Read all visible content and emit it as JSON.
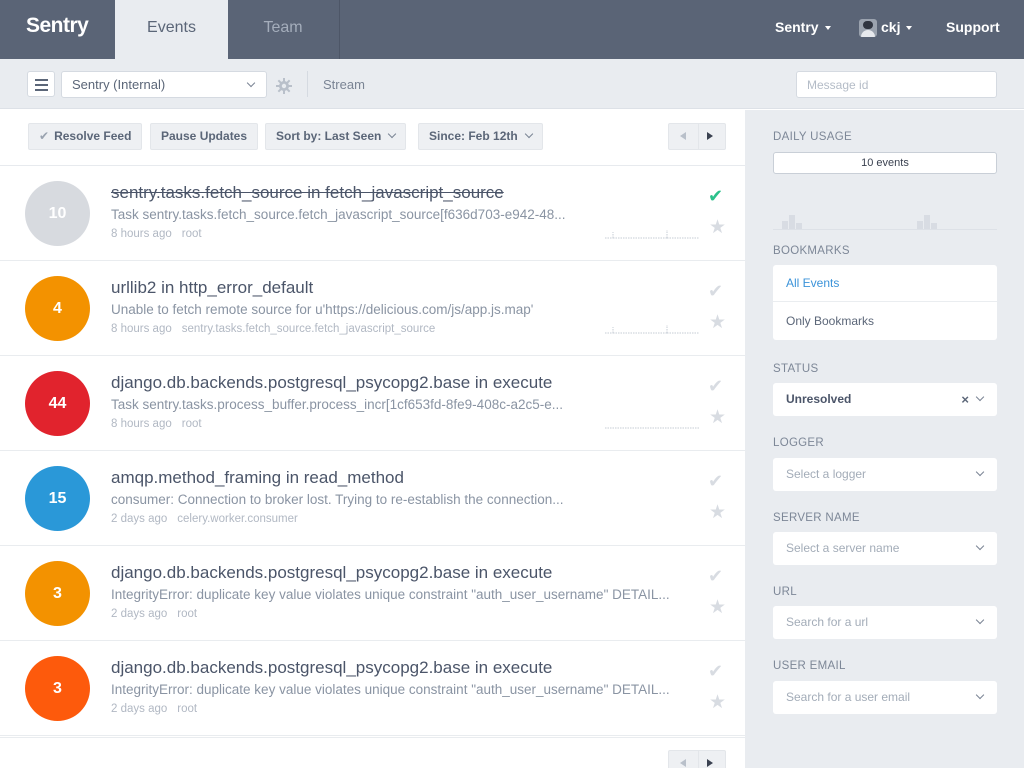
{
  "nav": {
    "brand": "Sentry",
    "tabs": [
      {
        "label": "Events"
      },
      {
        "label": "Team"
      }
    ],
    "org_menu": "Sentry",
    "user_menu": "ckj",
    "support": "Support",
    "colors": {
      "bar": "#5a6476",
      "active_tab": "#e9ecf0"
    }
  },
  "subbar": {
    "project": "Sentry (Internal)",
    "section": "Stream",
    "search": {
      "placeholder": "Message id",
      "value": ""
    }
  },
  "toolbar": {
    "resolve": "Resolve Feed",
    "pause": "Pause Updates",
    "sort": "Sort by: Last Seen",
    "since": "Since: Feb 12th"
  },
  "events": [
    {
      "count": "10",
      "color": "#d7dadf",
      "title": "sentry.tasks.fetch_source in fetch_javascript_source",
      "message": "Task sentry.tasks.fetch_source.fetch_javascript_source[f636d703-e942-48...",
      "time": "8 hours ago",
      "logger": "root",
      "resolved": true
    },
    {
      "count": "4",
      "color": "#f39200",
      "title": "urllib2 in http_error_default",
      "message": "Unable to fetch remote source for u'https://delicious.com/js/app.js.map'",
      "time": "8 hours ago",
      "logger": "sentry.tasks.fetch_source.fetch_javascript_source",
      "resolved": false
    },
    {
      "count": "44",
      "color": "#e1232d",
      "title": "django.db.backends.postgresql_psycopg2.base in execute",
      "message": "Task sentry.tasks.process_buffer.process_incr[1cf653fd-8fe9-408c-a2c5-e...",
      "time": "8 hours ago",
      "logger": "root",
      "resolved": false
    },
    {
      "count": "15",
      "color": "#2a98d8",
      "title": "amqp.method_framing in read_method",
      "message": "consumer: Connection to broker lost. Trying to re-establish the connection...",
      "time": "2 days ago",
      "logger": "celery.worker.consumer",
      "resolved": false
    },
    {
      "count": "3",
      "color": "#f39200",
      "title": "django.db.backends.postgresql_psycopg2.base in execute",
      "message": "IntegrityError: duplicate key value violates unique constraint \"auth_user_username\" DETAIL...",
      "time": "2 days ago",
      "logger": "root",
      "resolved": false
    },
    {
      "count": "3",
      "color": "#fd5a0c",
      "title": "django.db.backends.postgresql_psycopg2.base in execute",
      "message": "IntegrityError: duplicate key value violates unique constraint \"auth_user_username\" DETAIL...",
      "time": "2 days ago",
      "logger": "root",
      "resolved": false
    }
  ],
  "sidebar": {
    "daily_usage": {
      "label": "DAILY USAGE",
      "value": "10 events"
    },
    "bookmarks": {
      "label": "BOOKMARKS",
      "items": [
        "All Events",
        "Only Bookmarks"
      ]
    },
    "status": {
      "label": "STATUS",
      "value": "Unresolved"
    },
    "logger": {
      "label": "LOGGER",
      "placeholder": "Select a logger"
    },
    "server_name": {
      "label": "SERVER NAME",
      "placeholder": "Select a server name"
    },
    "url": {
      "label": "URL",
      "placeholder": "Search for a url"
    },
    "user_email": {
      "label": "USER EMAIL",
      "placeholder": "Search for a user email"
    }
  }
}
